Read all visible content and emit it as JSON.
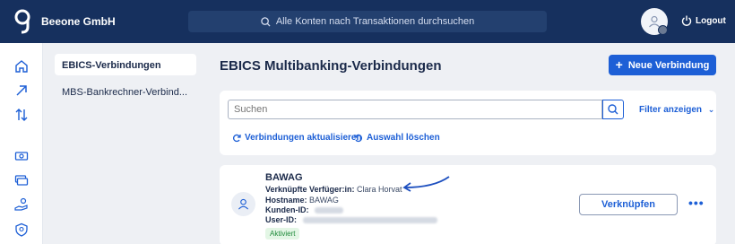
{
  "app": {
    "company": "Beeone GmbH"
  },
  "header": {
    "search_placeholder": "Alle Konten nach Transaktionen durchsuchen",
    "logout_label": "Logout"
  },
  "subnav": {
    "items": [
      {
        "label": "EBICS-Verbindungen",
        "active": true
      },
      {
        "label": "MBS-Bankrechner-Verbind..."
      }
    ]
  },
  "main": {
    "title": "EBICS Multibanking-Verbindungen",
    "new_button_label": "Neue Verbindung",
    "filter": {
      "search_placeholder": "Suchen",
      "toggle_label": "Filter anzeigen",
      "refresh_label": "Verbindungen aktualisieren",
      "clear_label": "Auswahl löschen"
    },
    "connection": {
      "bank_name": "BAWAG",
      "verfueger_label": "Verknüpfte Verfüger:in:",
      "verfueger_value": "Clara Horvat",
      "hostname_label": "Hostname:",
      "hostname_value": "BAWAG",
      "kunden_label": "Kunden-ID:",
      "user_label": "User-ID:",
      "status": "Aktiviert",
      "link_button_label": "Verknüpfen",
      "more_label": "•••"
    }
  },
  "colors": {
    "header": "#16305e",
    "accent": "#1d5fd6",
    "success": "#1f8a3a"
  }
}
